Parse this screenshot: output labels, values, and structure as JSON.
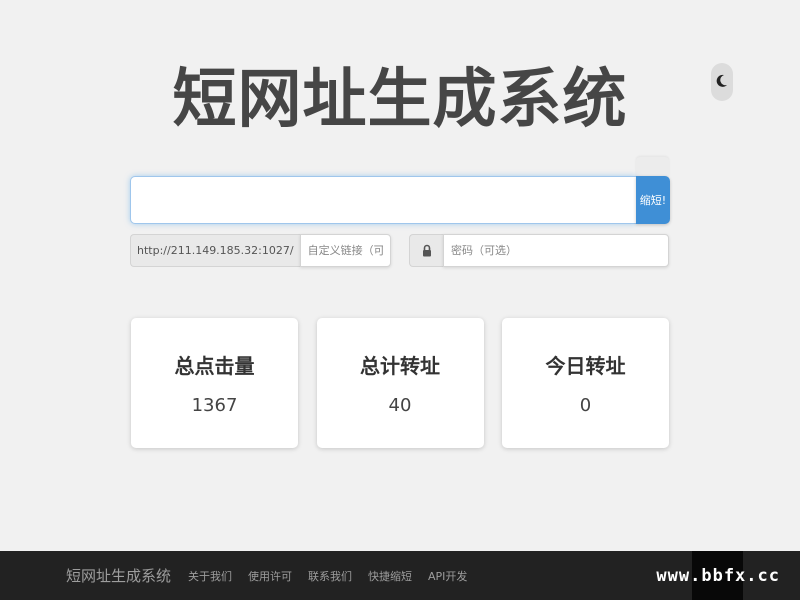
{
  "header": {
    "title": "短网址生成系统",
    "theme_toggle_icon": "moon-icon"
  },
  "shorten_form": {
    "url_value": "",
    "url_placeholder": "",
    "submit_label": "缩短!",
    "domain_prefix": "http://211.149.185.32:1027/",
    "custom_placeholder": "自定义链接（可选）",
    "lock_icon": "lock-icon",
    "password_placeholder": "密码（可选）"
  },
  "stats": [
    {
      "label": "总点击量",
      "value": "1367"
    },
    {
      "label": "总计转址",
      "value": "40"
    },
    {
      "label": "今日转址",
      "value": "0"
    }
  ],
  "footer": {
    "brand": "短网址生成系统",
    "links": [
      "关于我们",
      "使用许可",
      "联系我们",
      "快捷缩短",
      "API开发"
    ]
  },
  "watermark": "www.bbfx.cc",
  "colors": {
    "accent": "#3f8fd6",
    "background": "#f1f1f1",
    "footer": "#222222"
  }
}
